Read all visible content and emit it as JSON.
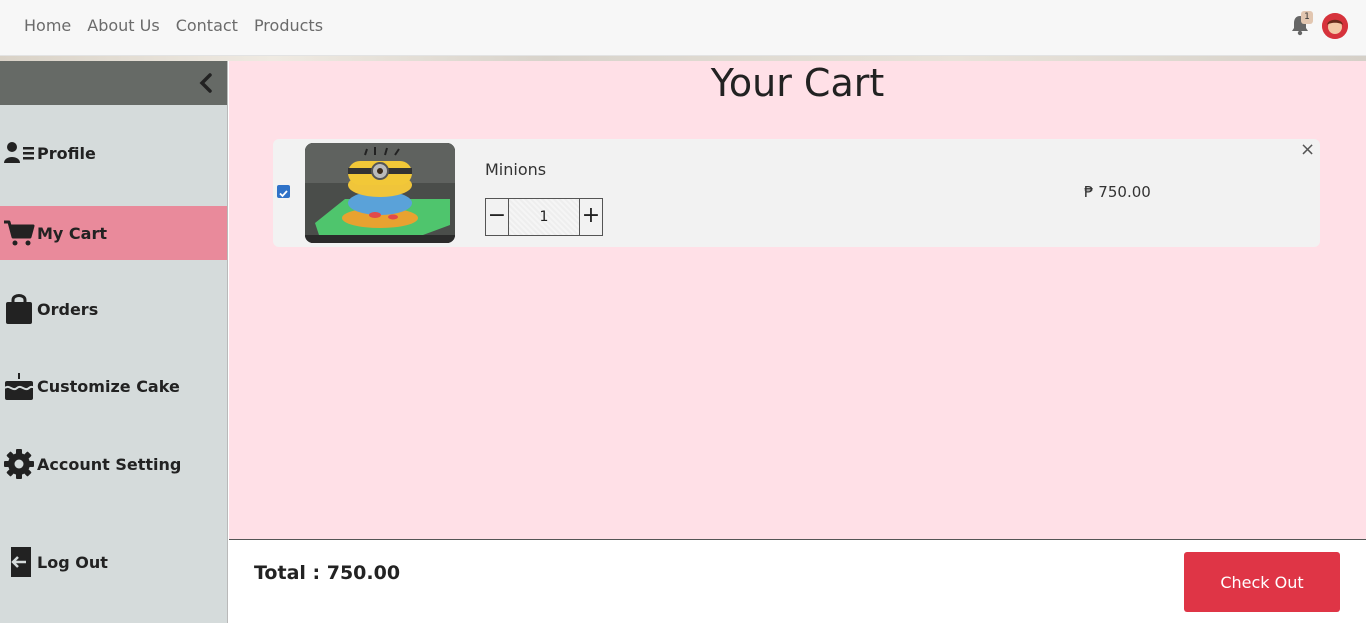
{
  "nav": {
    "links": [
      "Home",
      "About Us",
      "Contact",
      "Products"
    ],
    "notification_count": "1"
  },
  "sidebar": {
    "items": [
      {
        "label": "Profile",
        "icon": "profile-icon"
      },
      {
        "label": "My Cart",
        "icon": "cart-icon",
        "active": true
      },
      {
        "label": "Orders",
        "icon": "bag-icon"
      },
      {
        "label": "Customize Cake",
        "icon": "cake-icon"
      },
      {
        "label": "Account Setting",
        "icon": "gear-icon"
      },
      {
        "label": "Log Out",
        "icon": "logout-icon"
      }
    ]
  },
  "main": {
    "title": "Your Cart",
    "cart_items": [
      {
        "name": "Minions",
        "quantity": "1",
        "price": "₱ 750.00",
        "selected": true,
        "minus_label": "−",
        "plus_label": "+",
        "remove_label": "×"
      }
    ]
  },
  "footer": {
    "total": "Total : 750.00",
    "checkout_label": "Check Out"
  },
  "colors": {
    "accent_pink": "#ffe0e7",
    "active_item": "#e98a9b",
    "checkout_red": "#df3546",
    "sidebar_bg": "#d5dbdb"
  }
}
